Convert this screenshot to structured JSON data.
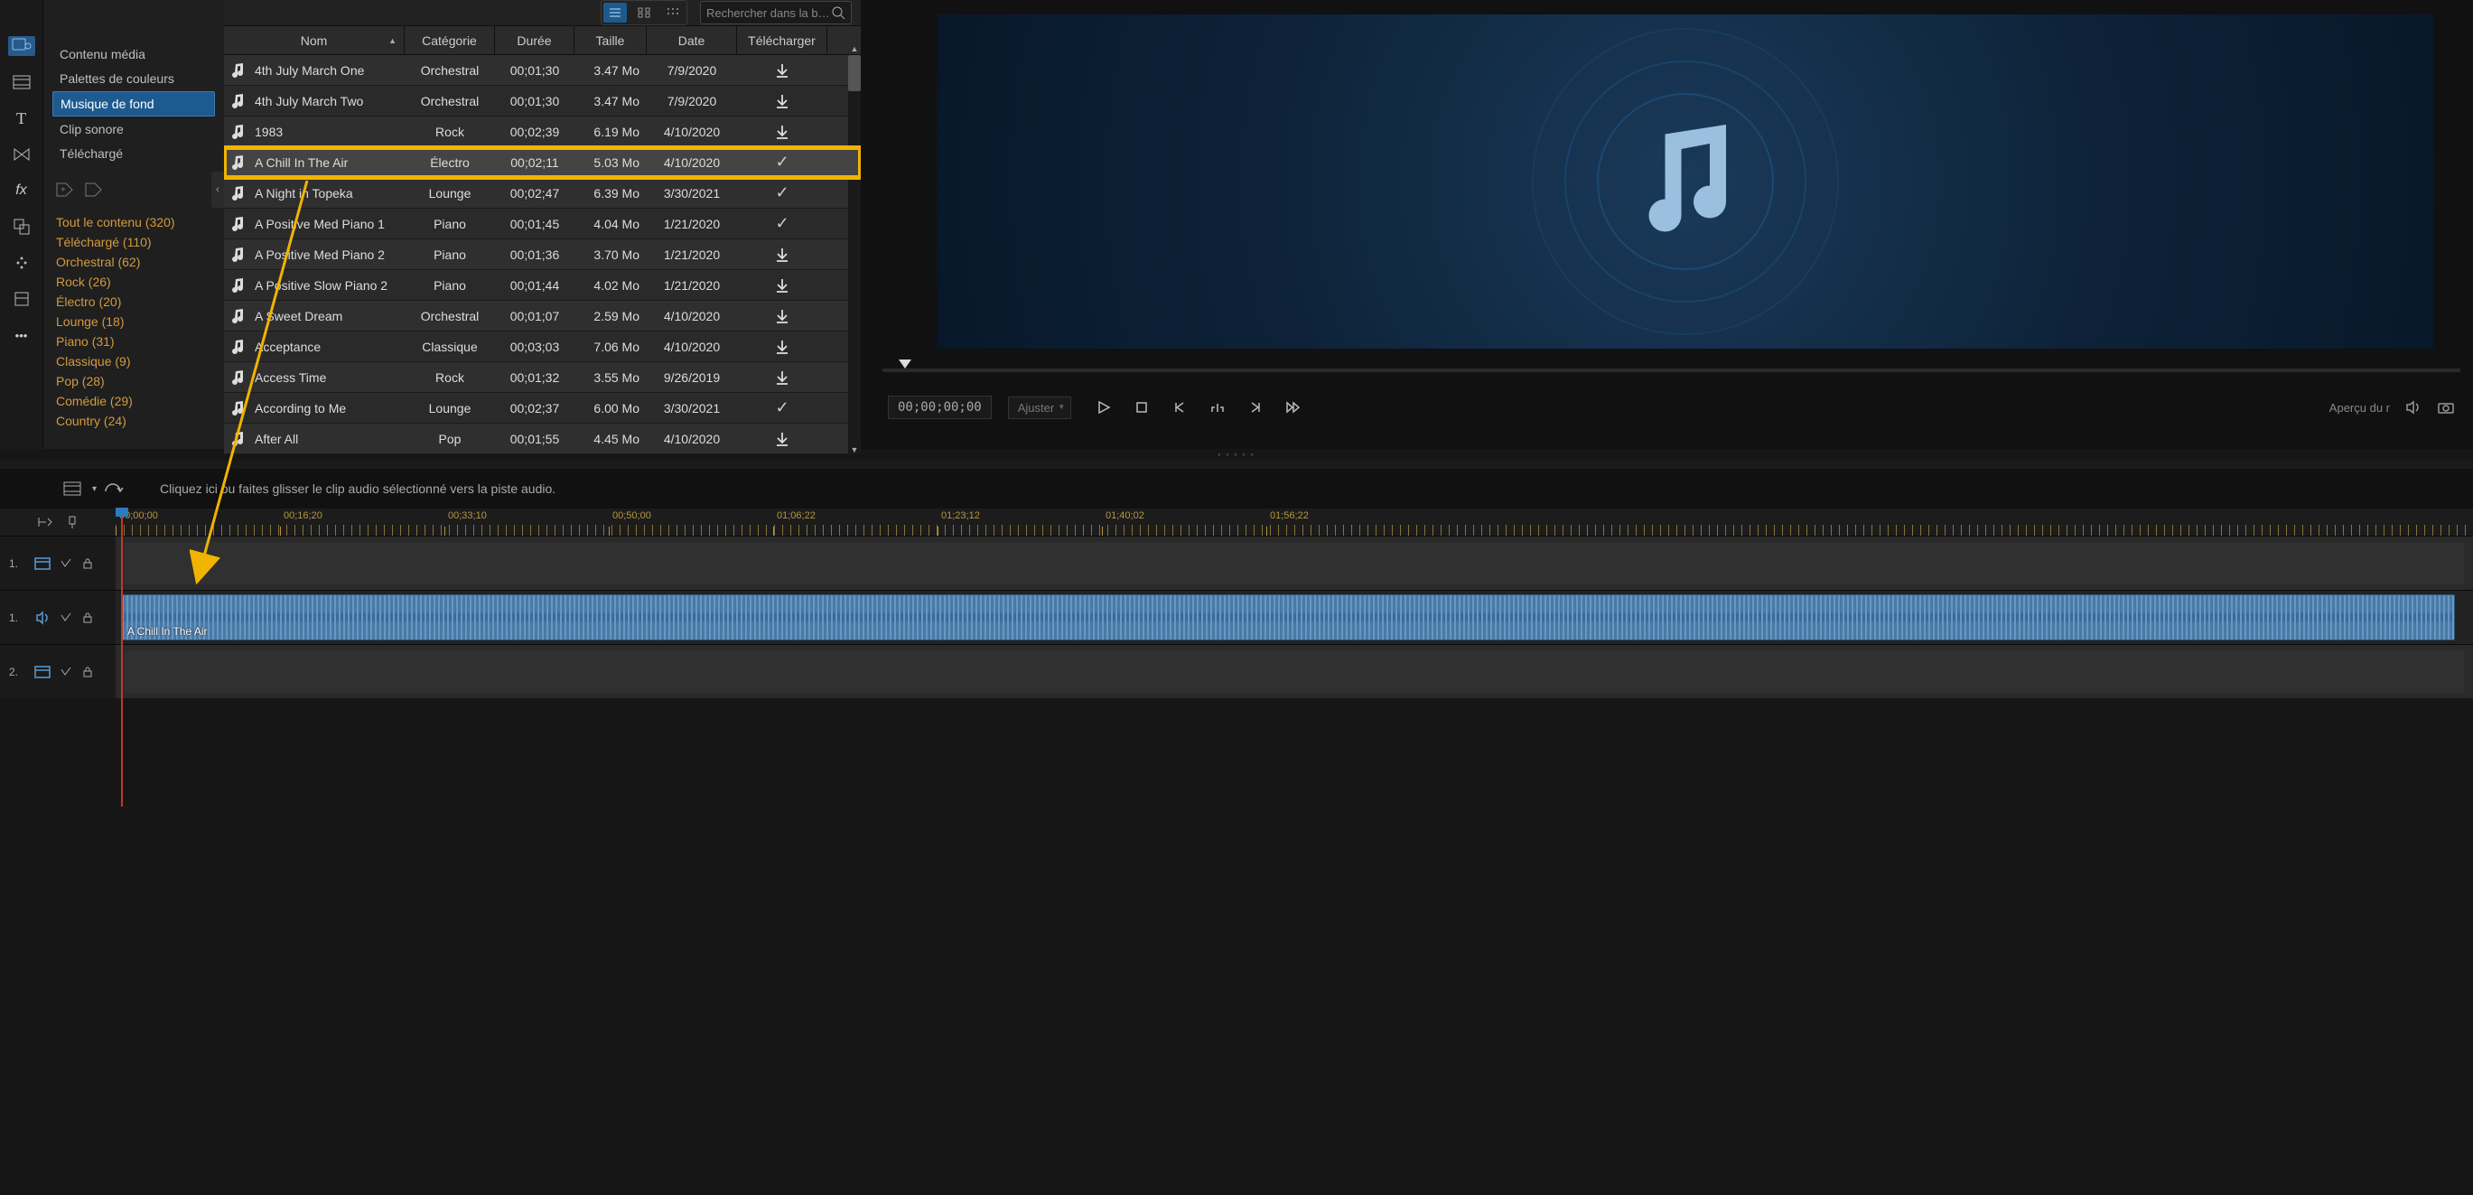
{
  "search": {
    "placeholder": "Rechercher dans la bibli…"
  },
  "sidebar": {
    "items": [
      {
        "label": "Contenu média"
      },
      {
        "label": "Palettes de couleurs"
      },
      {
        "label": "Musique de fond"
      },
      {
        "label": "Clip sonore"
      },
      {
        "label": "Téléchargé"
      }
    ]
  },
  "filters": [
    {
      "label": "Tout le contenu  (320)"
    },
    {
      "label": "Téléchargé  (110)"
    },
    {
      "label": "Orchestral  (62)"
    },
    {
      "label": "Rock  (26)"
    },
    {
      "label": "Électro  (20)"
    },
    {
      "label": "Lounge  (18)"
    },
    {
      "label": "Piano  (31)"
    },
    {
      "label": "Classique  (9)"
    },
    {
      "label": "Pop  (28)"
    },
    {
      "label": "Comédie  (29)"
    },
    {
      "label": "Country  (24)"
    }
  ],
  "columns": {
    "name": "Nom",
    "cat": "Catégorie",
    "dur": "Durée",
    "size": "Taille",
    "date": "Date",
    "dl": "Télécharger"
  },
  "tracks": [
    {
      "name": "4th July March One",
      "cat": "Orchestral",
      "dur": "00;01;30",
      "size": "3.47 Mo",
      "date": "7/9/2020",
      "dl": "download"
    },
    {
      "name": "4th July March Two",
      "cat": "Orchestral",
      "dur": "00;01;30",
      "size": "3.47 Mo",
      "date": "7/9/2020",
      "dl": "download"
    },
    {
      "name": "1983",
      "cat": "Rock",
      "dur": "00;02;39",
      "size": "6.19 Mo",
      "date": "4/10/2020",
      "dl": "download"
    },
    {
      "name": "A Chill In The Air",
      "cat": "Électro",
      "dur": "00;02;11",
      "size": "5.03 Mo",
      "date": "4/10/2020",
      "dl": "check",
      "highlight": true
    },
    {
      "name": "A Night in Topeka",
      "cat": "Lounge",
      "dur": "00;02;47",
      "size": "6.39 Mo",
      "date": "3/30/2021",
      "dl": "check"
    },
    {
      "name": "A Positive Med Piano 1",
      "cat": "Piano",
      "dur": "00;01;45",
      "size": "4.04 Mo",
      "date": "1/21/2020",
      "dl": "check"
    },
    {
      "name": "A Positive Med Piano 2",
      "cat": "Piano",
      "dur": "00;01;36",
      "size": "3.70 Mo",
      "date": "1/21/2020",
      "dl": "download"
    },
    {
      "name": "A Positive Slow Piano 2",
      "cat": "Piano",
      "dur": "00;01;44",
      "size": "4.02 Mo",
      "date": "1/21/2020",
      "dl": "download"
    },
    {
      "name": "A Sweet Dream",
      "cat": "Orchestral",
      "dur": "00;01;07",
      "size": "2.59 Mo",
      "date": "4/10/2020",
      "dl": "download"
    },
    {
      "name": "Acceptance",
      "cat": "Classique",
      "dur": "00;03;03",
      "size": "7.06 Mo",
      "date": "4/10/2020",
      "dl": "download"
    },
    {
      "name": "Access Time",
      "cat": "Rock",
      "dur": "00;01;32",
      "size": "3.55 Mo",
      "date": "9/26/2019",
      "dl": "download"
    },
    {
      "name": "According to Me",
      "cat": "Lounge",
      "dur": "00;02;37",
      "size": "6.00 Mo",
      "date": "3/30/2021",
      "dl": "check"
    },
    {
      "name": "After All",
      "cat": "Pop",
      "dur": "00;01;55",
      "size": "4.45 Mo",
      "date": "4/10/2020",
      "dl": "download"
    }
  ],
  "preview": {
    "timecode": "00;00;00;00",
    "fit_label": "Ajuster",
    "apercu": "Aperçu du r"
  },
  "drop_hint": "Cliquez ici ou faites glisser le clip audio sélectionné vers la piste audio.",
  "ruler_times": [
    "00;00;00",
    "00;16;20",
    "00;33;10",
    "00;50;00",
    "01;06;22",
    "01;23;12",
    "01;40;02",
    "01;56;22"
  ],
  "timeline_tracks": [
    {
      "num": "1.",
      "kind": "video"
    },
    {
      "num": "1.",
      "kind": "audio",
      "clip": "A Chill In The Air"
    },
    {
      "num": "2.",
      "kind": "video2"
    }
  ]
}
